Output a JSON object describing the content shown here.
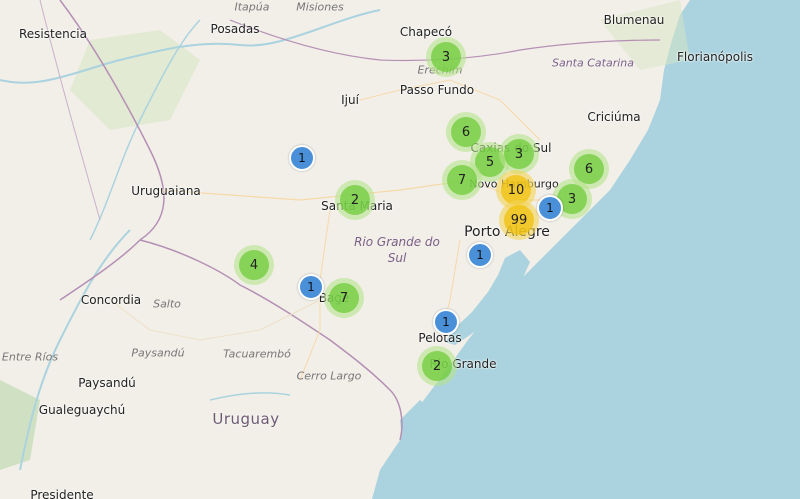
{
  "map": {
    "cities": [
      {
        "id": "resistencia",
        "name": "Resistencia"
      },
      {
        "id": "posadas",
        "name": "Posadas"
      },
      {
        "id": "chapeco",
        "name": "Chapecó"
      },
      {
        "id": "blumenau",
        "name": "Blumenau"
      },
      {
        "id": "florianopolis",
        "name": "Florianópolis"
      },
      {
        "id": "passo-fundo",
        "name": "Passo Fundo"
      },
      {
        "id": "erechim",
        "name": "Erechim"
      },
      {
        "id": "ijui",
        "name": "Ijuí"
      },
      {
        "id": "criciuma",
        "name": "Criciúma"
      },
      {
        "id": "caxias",
        "name": "Caxias do Sul"
      },
      {
        "id": "novo-hamburgo",
        "name": "Novo Hamburgo"
      },
      {
        "id": "uruguaiana",
        "name": "Uruguaiana"
      },
      {
        "id": "santa-maria",
        "name": "Santa Maria"
      },
      {
        "id": "porto-alegre",
        "name": "Porto Alegre"
      },
      {
        "id": "concordia",
        "name": "Concordia"
      },
      {
        "id": "salto",
        "name": "Salto"
      },
      {
        "id": "bage",
        "name": "Bagé"
      },
      {
        "id": "pelotas",
        "name": "Pelotas"
      },
      {
        "id": "rio-grande",
        "name": "Rio Grande"
      },
      {
        "id": "paysandu",
        "name": "Paysandú"
      },
      {
        "id": "tacuarembo",
        "name": "Tacuarembó"
      },
      {
        "id": "cerro-largo",
        "name": "Cerro Largo"
      },
      {
        "id": "gualeguaychu",
        "name": "Gualeguaychú"
      },
      {
        "id": "presidente",
        "name": "Presidente"
      },
      {
        "id": "itapua",
        "name": "Itapúa"
      },
      {
        "id": "misiones",
        "name": "Misiones"
      }
    ],
    "regions": [
      {
        "id": "santa-catarina",
        "name": "Santa Catarina"
      },
      {
        "id": "rio-grande-do-sul",
        "name": "Rio Grande do Sul"
      },
      {
        "id": "entre-rios",
        "name": "Entre Ríos"
      },
      {
        "id": "uruguay",
        "name": "Uruguay"
      }
    ],
    "clusters": [
      {
        "count": "3",
        "kind": "small"
      },
      {
        "count": "6",
        "kind": "small"
      },
      {
        "count": "5",
        "kind": "small"
      },
      {
        "count": "3",
        "kind": "small"
      },
      {
        "count": "7",
        "kind": "small"
      },
      {
        "count": "10",
        "kind": "medium"
      },
      {
        "count": "99",
        "kind": "medium"
      },
      {
        "count": "6",
        "kind": "small"
      },
      {
        "count": "3",
        "kind": "small"
      },
      {
        "count": "2",
        "kind": "small"
      },
      {
        "count": "4",
        "kind": "small"
      },
      {
        "count": "7",
        "kind": "small"
      },
      {
        "count": "2",
        "kind": "small"
      }
    ],
    "markers": [
      {
        "count": "1"
      },
      {
        "count": "1"
      },
      {
        "count": "1"
      },
      {
        "count": "1"
      },
      {
        "count": "1"
      }
    ],
    "colors": {
      "land": "#f2efe9",
      "ocean": "#aad3df",
      "cluster_small": "#6ecc39",
      "cluster_medium": "#f0c20c",
      "marker": "#4a90d9"
    }
  }
}
